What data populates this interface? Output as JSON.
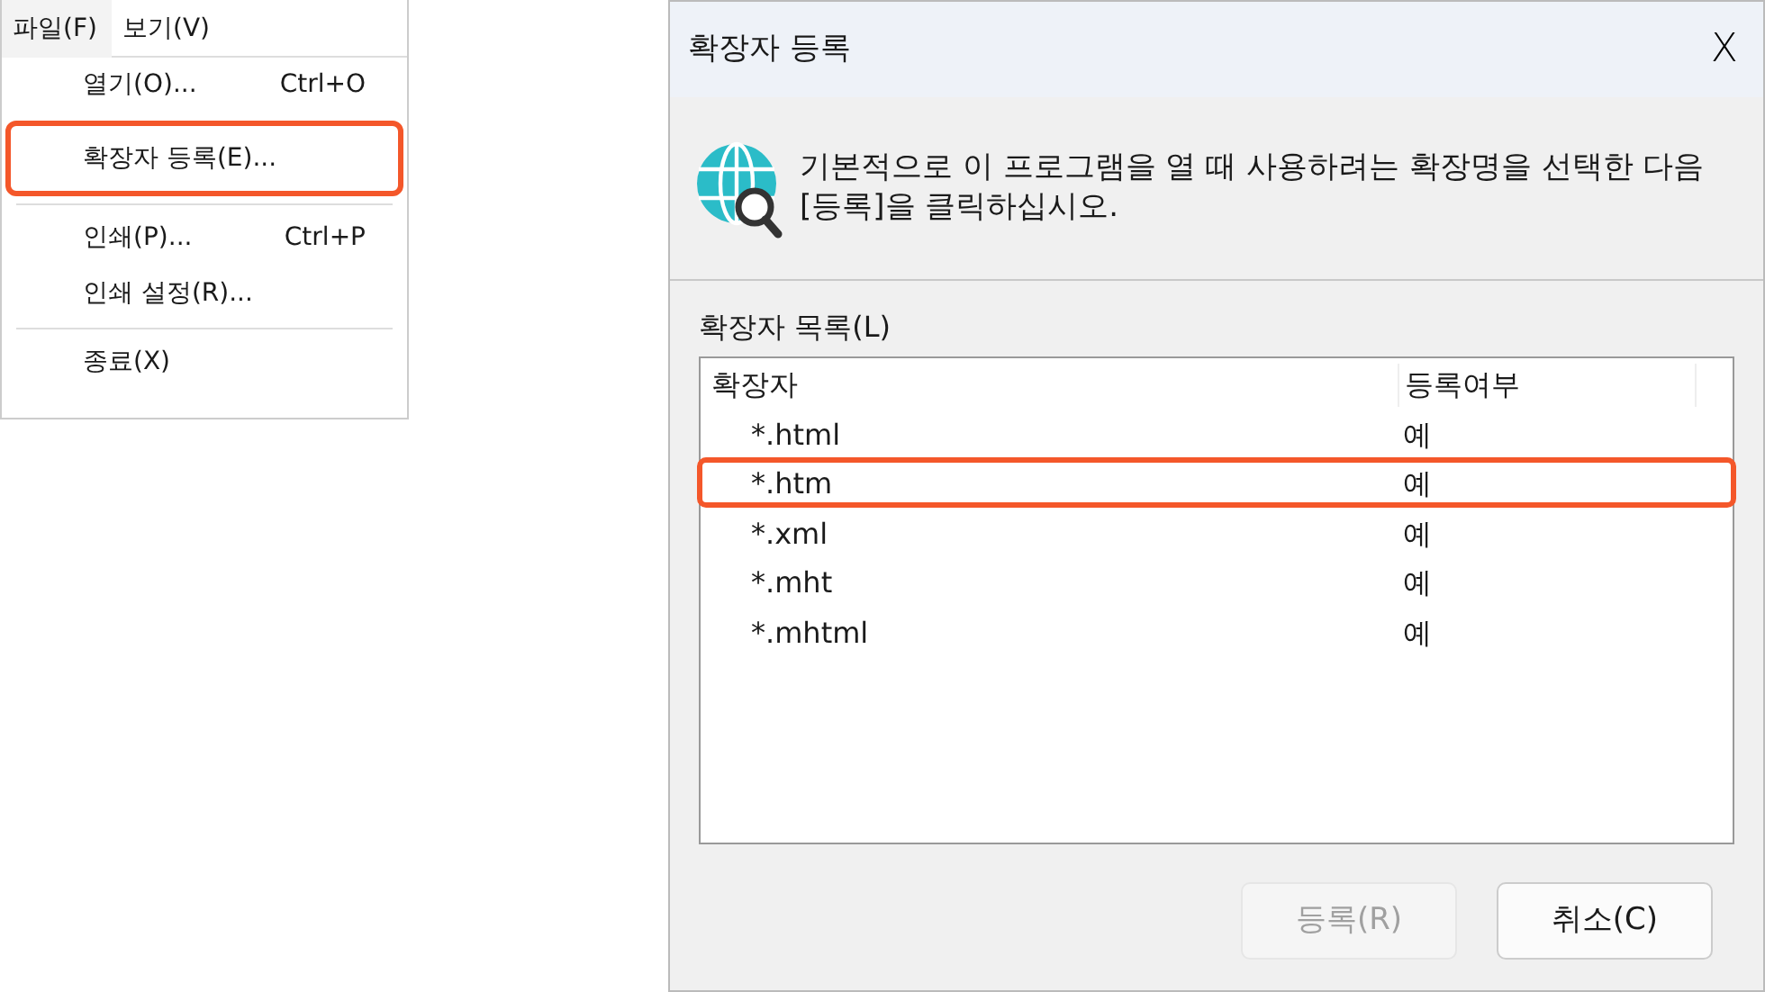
{
  "menu_bar": {
    "items": [
      {
        "label": "파일(F)",
        "selected": true
      },
      {
        "label": "보기(V)",
        "selected": false
      }
    ]
  },
  "file_menu": {
    "items": [
      {
        "kind": "item",
        "label": "열기(O)...",
        "shortcut": "Ctrl+O",
        "highlighted": false
      },
      {
        "kind": "item",
        "label": "확장자 등록(E)...",
        "highlighted": true
      },
      {
        "kind": "separator"
      },
      {
        "kind": "item",
        "label": "인쇄(P)...",
        "shortcut": "Ctrl+P",
        "highlighted": false
      },
      {
        "kind": "item",
        "label": "인쇄 설정(R)...",
        "highlighted": false
      },
      {
        "kind": "separator"
      },
      {
        "kind": "item",
        "label": "종료(X)",
        "highlighted": false
      }
    ]
  },
  "dialog": {
    "title": "확장자 등록",
    "close": "X",
    "message": "기본적으로 이 프로그램을 열 때 사용하려는 확장명을 선택한 다음 [등록]을 클릭하십시오.",
    "list_label": "확장자 목록(L)",
    "columns": [
      "확장자",
      "등록여부"
    ],
    "rows": [
      {
        "extension": "*.html",
        "registered": "예",
        "highlighted": false
      },
      {
        "extension": "*.htm",
        "registered": "예",
        "highlighted": true
      },
      {
        "extension": "*.xml",
        "registered": "예",
        "highlighted": false
      },
      {
        "extension": "*.mht",
        "registered": "예",
        "highlighted": false
      },
      {
        "extension": "*.mhtml",
        "registered": "예",
        "highlighted": false
      }
    ],
    "buttons": [
      {
        "label": "등록(R)",
        "disabled": true
      },
      {
        "label": "취소(C)",
        "disabled": false
      }
    ]
  }
}
